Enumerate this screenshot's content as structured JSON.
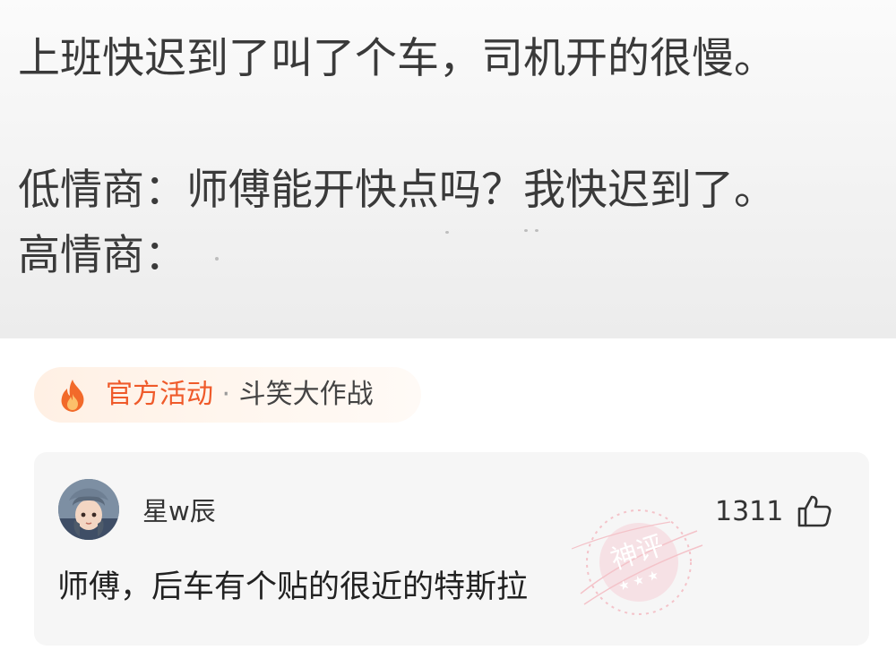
{
  "post": {
    "line1": "上班快迟到了叫了个车，司机开的很慢。",
    "line2": "低情商：师傅能开快点吗？我快迟到了。",
    "line3": "高情商："
  },
  "activity": {
    "icon": "fire-icon",
    "label": "官方活动",
    "separator": " · ",
    "name": "斗笑大作战",
    "accent_color": "#ef5a2a"
  },
  "comment": {
    "username": "星w辰",
    "like_count": "1311",
    "text": "师傅，后车有个贴的很近的特斯拉",
    "badge": {
      "label": "神评",
      "color": "#f05a6e"
    }
  }
}
